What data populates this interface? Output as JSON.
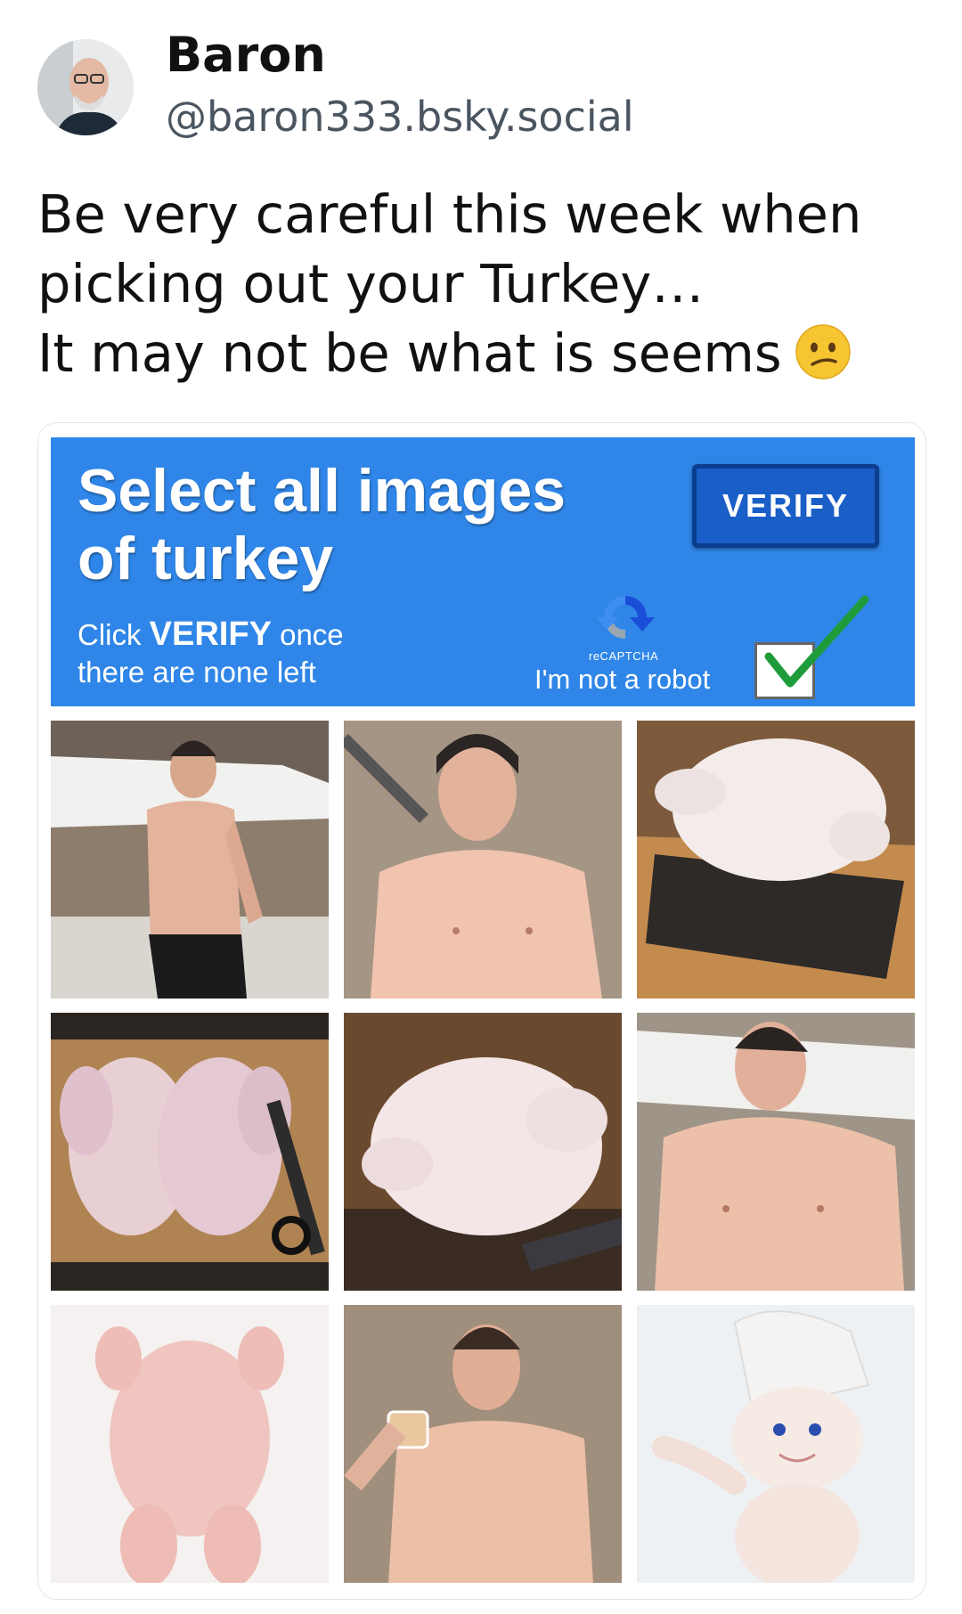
{
  "author": {
    "name": "Baron",
    "handle": "@baron333.bsky.social"
  },
  "post": {
    "lines": [
      "Be very careful this week when",
      "picking out your Turkey…",
      "It may not be what is seems"
    ],
    "emoji": "confused-face-icon"
  },
  "captcha": {
    "title_lines": [
      "Select all images",
      "of turkey"
    ],
    "verify_label": "VERIFY",
    "instruction_prefix": "Click ",
    "instruction_bold": "VERIFY",
    "instruction_suffix": " once",
    "instruction_line2": "there are none left",
    "recaptcha_label": "reCAPTCHA",
    "robot_label": "I'm not a robot",
    "robot_checked": true,
    "colors": {
      "header": "#2f86e8",
      "button": "#1a5fc8",
      "check": "#1e9c3c"
    },
    "tiles": [
      "shirtless-man-on-boat-photo",
      "shirtless-man-closeup-photo",
      "raw-turkey-on-board-photo",
      "two-raw-chickens-with-scissors-photo",
      "raw-turkey-on-wood-photo",
      "shirtless-man-on-boat-photo",
      "raw-chicken-on-white-photo",
      "shirtless-man-with-drink-photo",
      "dough-mascot-figure-photo"
    ]
  }
}
